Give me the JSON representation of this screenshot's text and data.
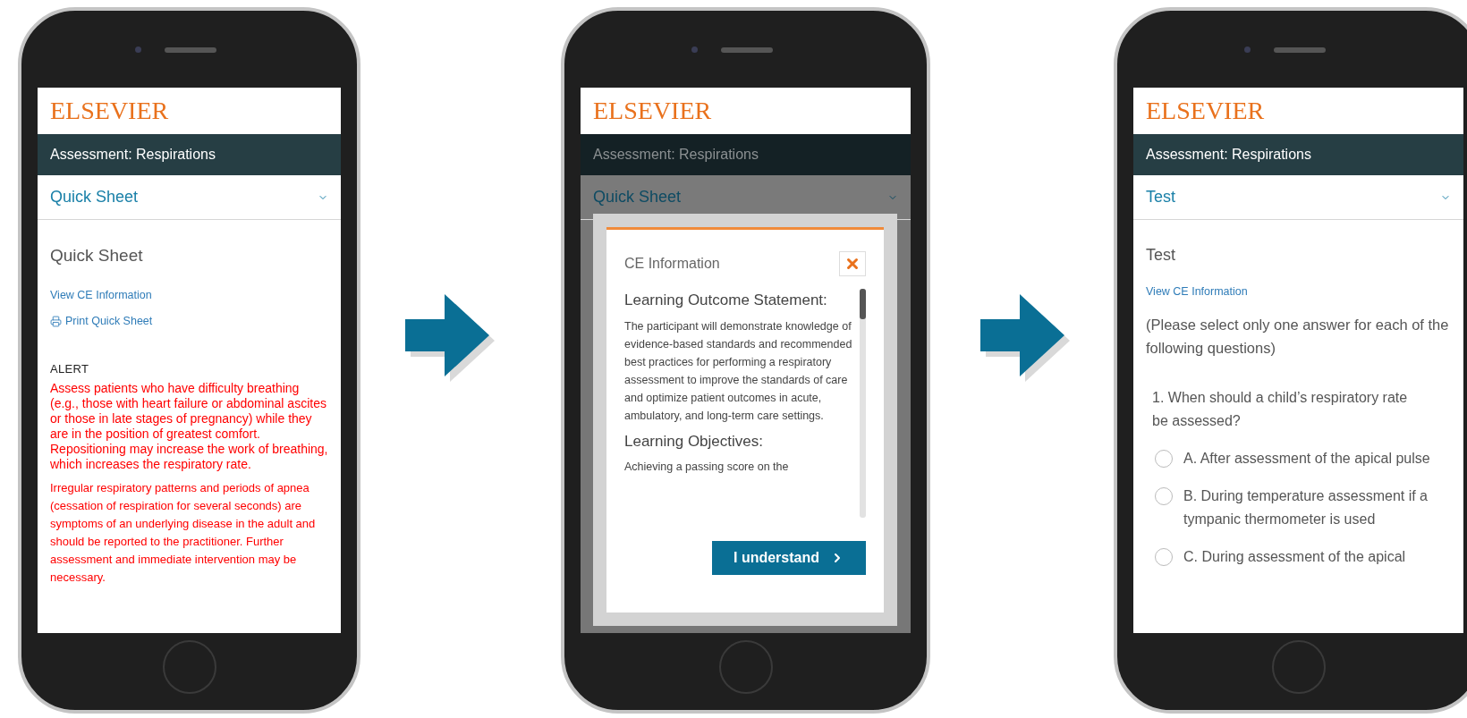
{
  "screens": [
    {
      "kind": "quick_sheet",
      "logo": "ELSEVIER",
      "header": "Assessment: Respirations",
      "section": "Quick Sheet",
      "heading": "Quick Sheet",
      "links": [
        {
          "label": "View CE Information",
          "kind": "link"
        },
        {
          "label": "Print Quick Sheet",
          "kind": "print"
        }
      ],
      "alert": {
        "title": "ALERT",
        "paragraphs": [
          "Assess patients who have difficulty breathing (e.g., those with heart failure or abdominal ascites or those in late stages of pregnancy) while they are in the position of greatest comfort. Repositioning may increase the work of breathing, which increases the respiratory rate.",
          "Irregular respiratory patterns and periods of apnea (cessation of respiration for several seconds) are symptoms of an underlying disease in the adult and should be reported to the practitioner. Further assessment and immediate intervention may be necessary."
        ]
      }
    },
    {
      "kind": "ce_modal",
      "logo": "ELSEVIER",
      "header": "Assessment: Respirations",
      "section": "Quick Sheet",
      "modal": {
        "title": "CE Information",
        "sections": [
          {
            "heading": "Learning Outcome Statement:",
            "text": "The participant will demonstrate knowledge of evidence-based standards and recommended best practices for performing a respiratory assessment to improve the standards of care and optimize patient outcomes in acute, ambulatory, and long-term care settings."
          },
          {
            "heading": "Learning Objectives:",
            "text": "Achieving a passing score on the"
          }
        ],
        "button": "I understand"
      }
    },
    {
      "kind": "test",
      "logo": "ELSEVIER",
      "header": "Assessment: Respirations",
      "section": "Test",
      "heading": "Test",
      "links": [
        {
          "label": "View CE Information",
          "kind": "link"
        }
      ],
      "instructions": "(Please select only one answer for each of the following questions)",
      "question": {
        "text": "1. When should a child’s respiratory rate be assessed?",
        "options": [
          {
            "label": "A. After assessment of the apical pulse",
            "selected": false
          },
          {
            "label": "B. During temperature assessment if a tympanic thermometer is used",
            "selected": false
          },
          {
            "label": "C. During assessment of the apical",
            "selected": false
          }
        ]
      }
    }
  ]
}
